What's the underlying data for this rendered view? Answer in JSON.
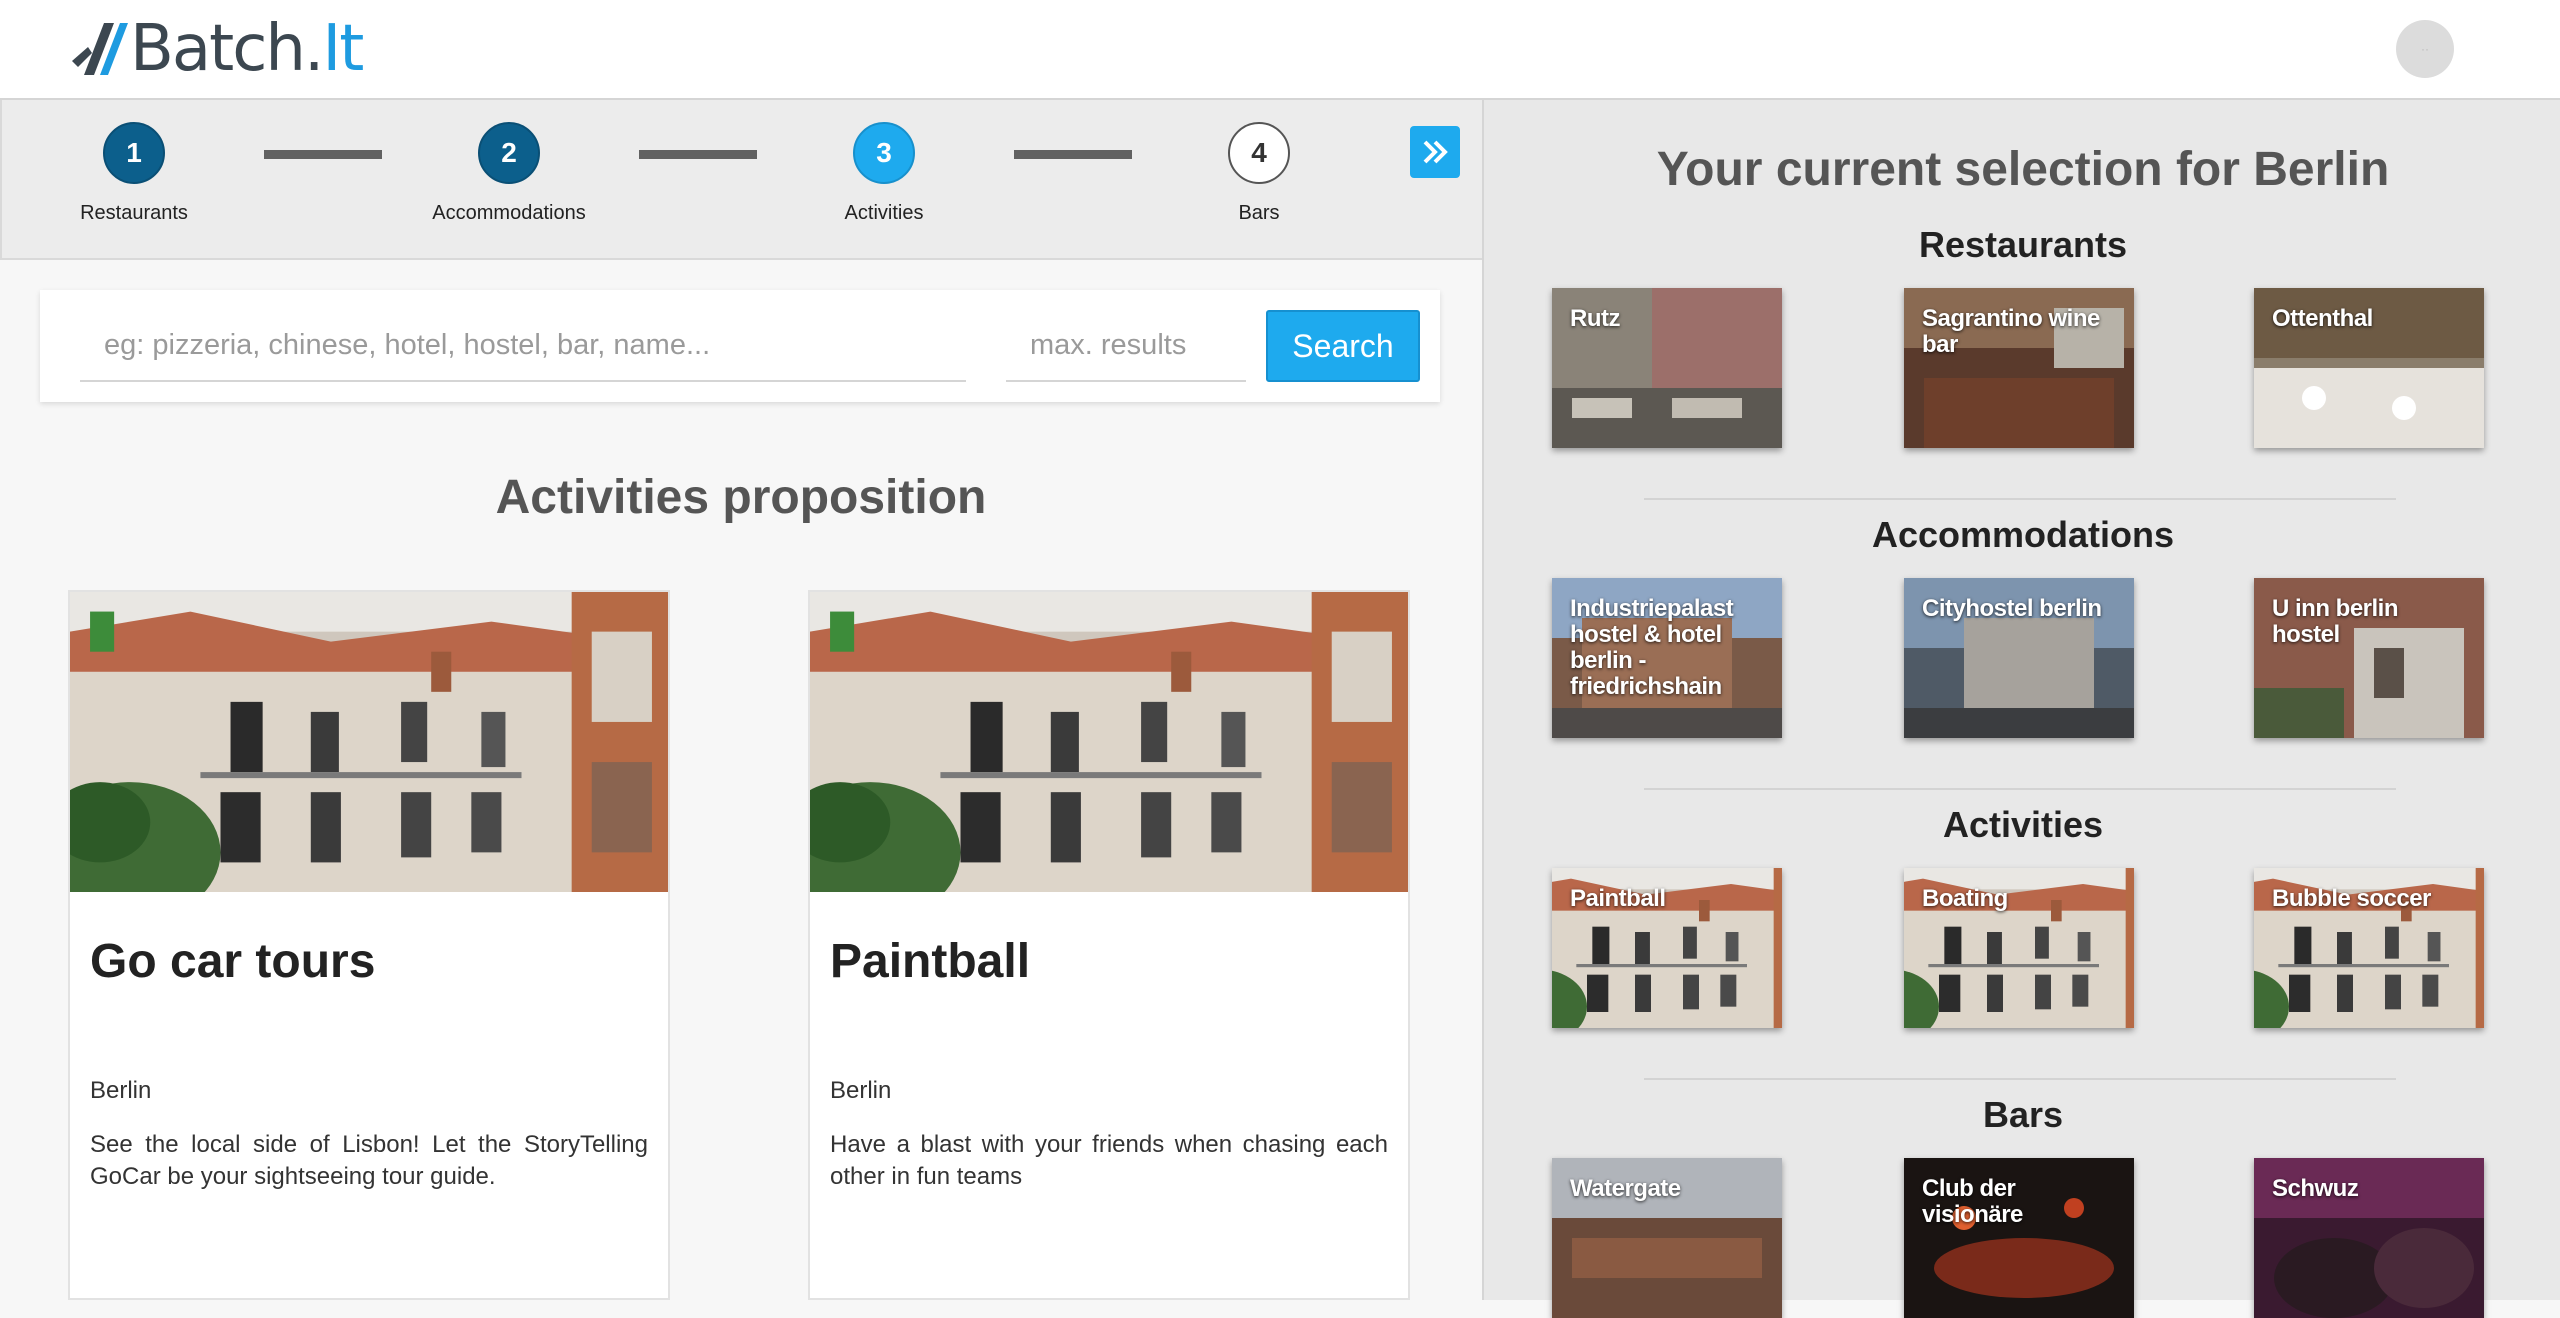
{
  "app": {
    "logo_text_dark": "Batch.",
    "logo_text_blue": "It",
    "avatar_text": "··"
  },
  "steps": [
    {
      "number": "1",
      "label": "Restaurants",
      "state": "done"
    },
    {
      "number": "2",
      "label": "Accommodations",
      "state": "done"
    },
    {
      "number": "3",
      "label": "Activities",
      "state": "active"
    },
    {
      "number": "4",
      "label": "Bars",
      "state": "todo"
    }
  ],
  "search": {
    "placeholder": "eg: pizzeria, chinese, hotel, hostel, bar, name...",
    "max_placeholder": "max. results",
    "button_label": "Search"
  },
  "proposition": {
    "title": "Activities proposition",
    "cards": [
      {
        "title": "Go car tours",
        "city": "Berlin",
        "description": "See the local side of Lisbon! Let the StoryTelling GoCar be your sightseeing tour guide."
      },
      {
        "title": "Paintball",
        "city": "Berlin",
        "description": "Have a blast with your friends when chasing each other in fun teams"
      }
    ]
  },
  "selection": {
    "title": "Your current selection for Berlin",
    "categories": [
      {
        "name": "Restaurants",
        "items": [
          "Rutz",
          "Sagrantino wine bar",
          "Ottenthal"
        ]
      },
      {
        "name": "Accommodations",
        "items": [
          "Industriepalast hostel & hotel berlin - friedrichshain",
          "Cityhostel berlin",
          "U inn berlin hostel"
        ]
      },
      {
        "name": "Activities",
        "items": [
          "Paintball",
          "Boating",
          "Bubble soccer"
        ]
      },
      {
        "name": "Bars",
        "items": [
          "Watergate",
          "Club der visionäre",
          "Schwuz"
        ]
      }
    ]
  },
  "colors": {
    "accent": "#1eaaee",
    "step_done": "#0c5f8c",
    "brand_dark": "#3c4750",
    "brand_blue": "#1e9be0"
  }
}
